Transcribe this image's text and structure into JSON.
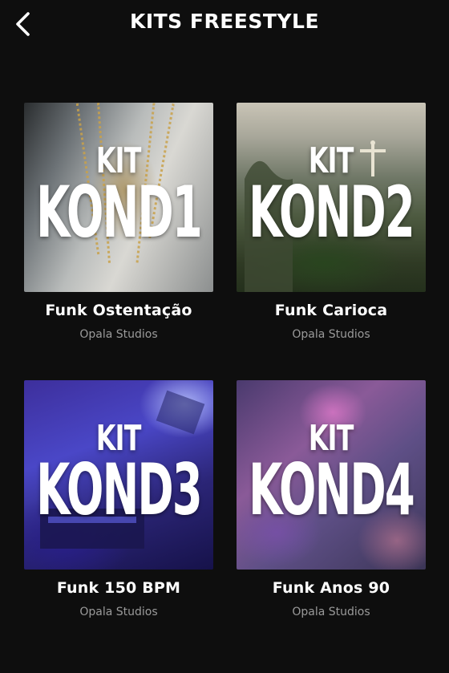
{
  "header": {
    "title": "KITS FREESTYLE",
    "back_icon": "chevron-left-icon"
  },
  "kits": [
    {
      "cover_kit_label": "KIT",
      "cover_name": "KOND1",
      "title": "Funk Ostentação",
      "subtitle": "Opala Studios"
    },
    {
      "cover_kit_label": "KIT",
      "cover_name": "KOND2",
      "title": "Funk Carioca",
      "subtitle": "Opala Studios"
    },
    {
      "cover_kit_label": "KIT",
      "cover_name": "KOND3",
      "title": "Funk 150 BPM",
      "subtitle": "Opala Studios"
    },
    {
      "cover_kit_label": "KIT",
      "cover_name": "KOND4",
      "title": "Funk Anos 90",
      "subtitle": "Opala Studios"
    }
  ],
  "colors": {
    "background": "#0e0e0e",
    "text_primary": "#ffffff",
    "text_secondary": "#9a9a9a"
  }
}
